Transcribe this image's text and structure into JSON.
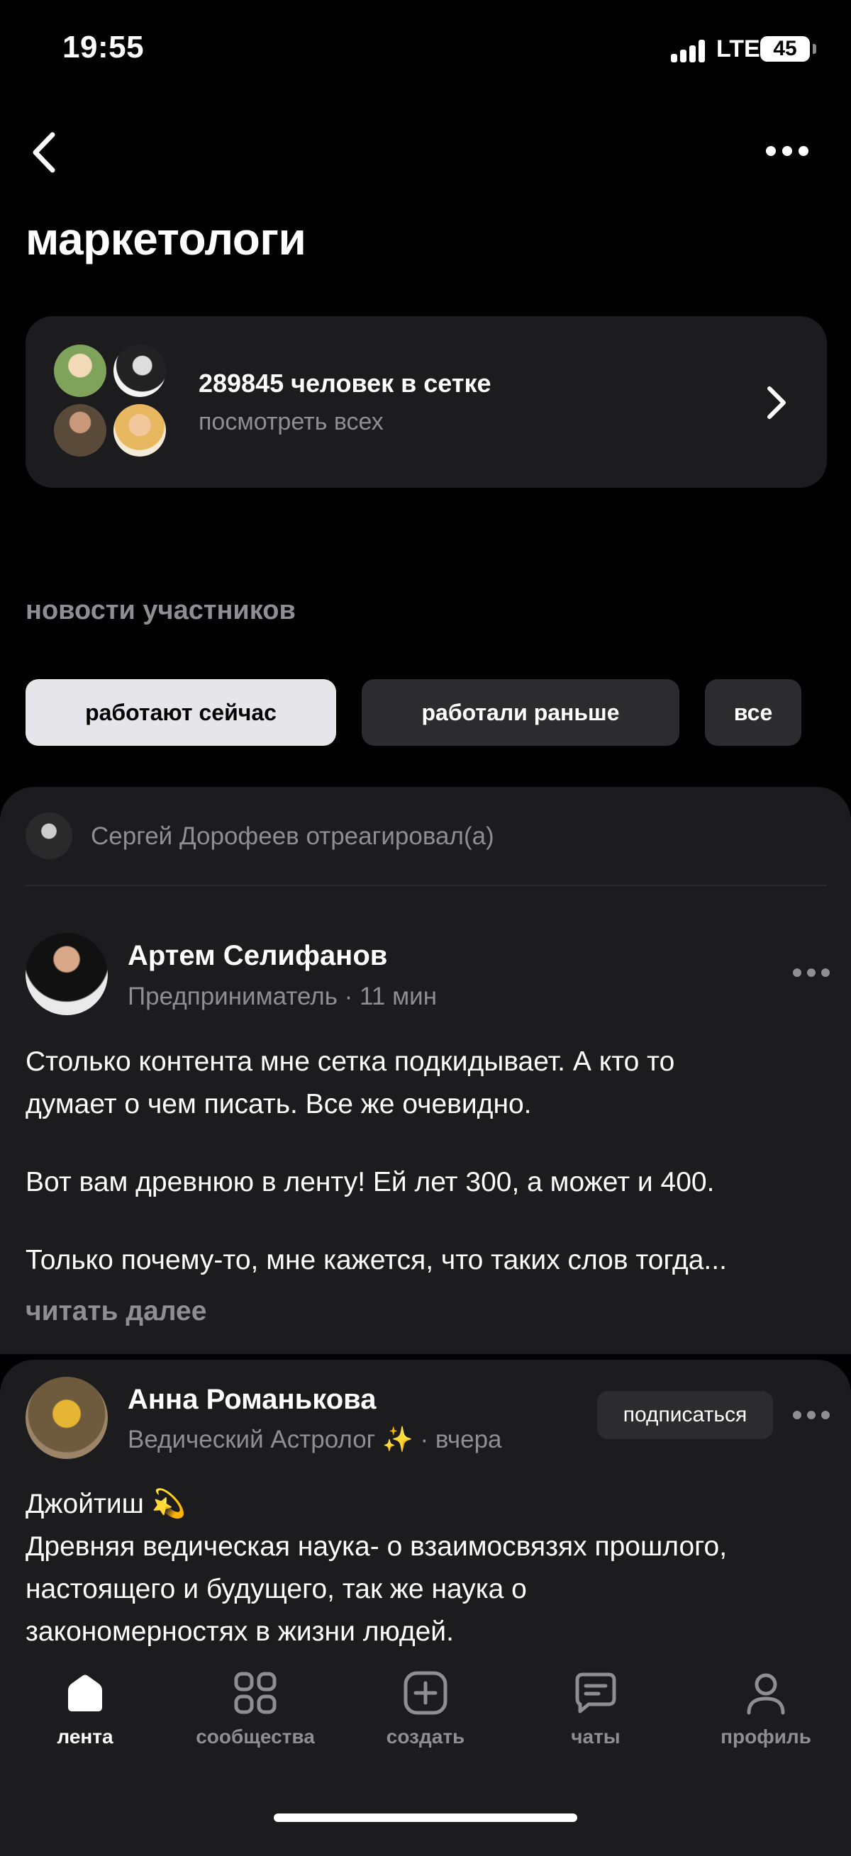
{
  "status_bar": {
    "time": "19:55",
    "network": "LTE",
    "battery": "45"
  },
  "header": {
    "title": "маркетологи"
  },
  "network_card": {
    "count_text": "289845 человек в сетке",
    "subtitle": "посмотреть всех"
  },
  "section": {
    "title": "новости участников",
    "chips": [
      {
        "label": "работают сейчас",
        "active": true
      },
      {
        "label": "работали раньше",
        "active": false
      },
      {
        "label": "все",
        "active": false
      }
    ]
  },
  "post1": {
    "reaction": "Сергей Дорофеев отреагировал(а)",
    "author": "Артем Селифанов",
    "meta": "Предприниматель · 11 мин",
    "lines": [
      "Столько контента мне сетка подкидывает. А кто то",
      "думает о чем писать. Все же очевидно.",
      "Вот вам древнюю в ленту! Ей лет 300, а может и 400.",
      "Только почему-то, мне кажется, что таких слов тогда..."
    ],
    "read_more": "читать далее"
  },
  "post2": {
    "author": "Анна Романькова",
    "meta": "Ведический Астролог ✨ · вчера",
    "subscribe": "подписаться",
    "lines": [
      "Джойтиш 💫",
      "Древняя ведическая наука- о взаимосвязях прошлого,",
      "настоящего и будущего, так же наука о",
      "закономерностях в жизни людей."
    ]
  },
  "tab_bar": {
    "tabs": [
      {
        "label": "лента",
        "icon": "home-icon",
        "active": true
      },
      {
        "label": "сообщества",
        "icon": "grid-icon",
        "active": false
      },
      {
        "label": "создать",
        "icon": "plus-square-icon",
        "active": false
      },
      {
        "label": "чаты",
        "icon": "chat-icon",
        "active": false
      },
      {
        "label": "профиль",
        "icon": "person-icon",
        "active": false
      }
    ]
  },
  "colors": {
    "background": "#000000",
    "card": "#1c1c1e",
    "chip": "#2c2c2e",
    "chip_active": "#e5e5ea",
    "secondary_text": "#8e8e93"
  }
}
